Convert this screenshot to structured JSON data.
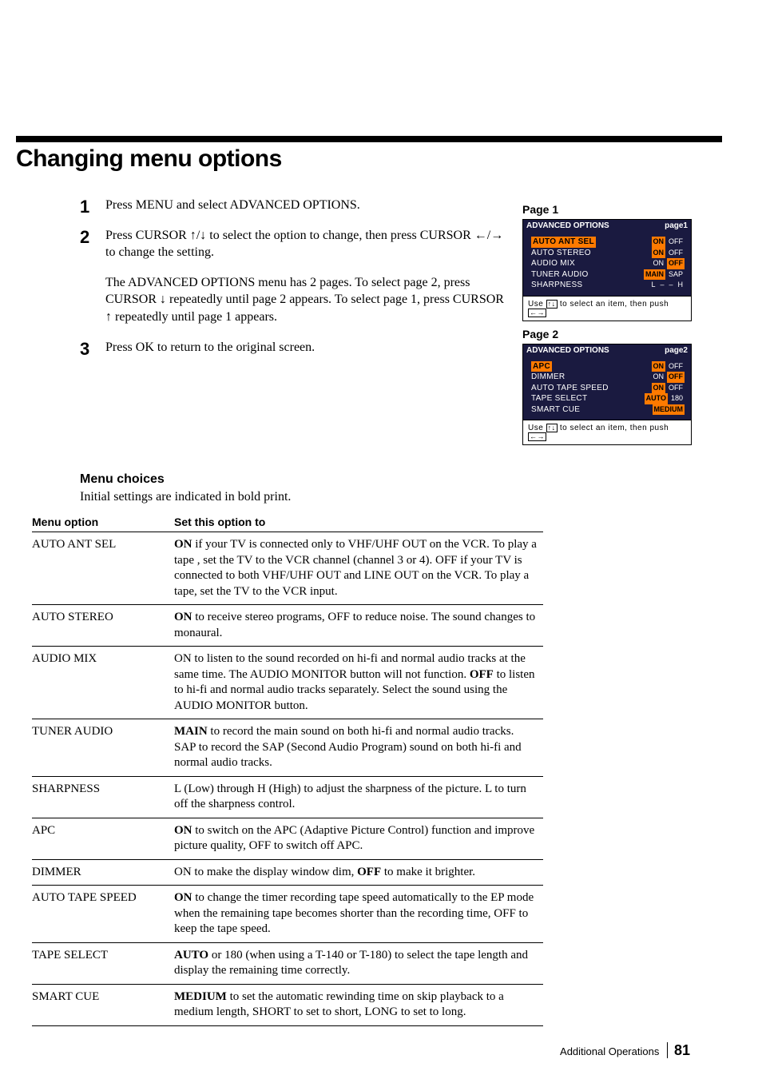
{
  "header": {
    "title": "Changing menu options"
  },
  "steps": [
    {
      "n": "1",
      "html": "Press MENU and select ADVANCED OPTIONS."
    },
    {
      "n": "2",
      "html": "Press CURSOR <span class='arrow-icon' data-name='arrow-up-icon'>↑</span>/<span class='arrow-icon' data-name='arrow-down-icon'>↓</span> to select the option to change, then press CURSOR <span class='arrow-icon' data-name='arrow-left-icon'>←</span>/<span class='arrow-icon' data-name='arrow-right-icon'>→</span> to change the setting."
    },
    {
      "n": "",
      "html": "The ADVANCED OPTIONS menu has 2 pages. To select page 2, press CURSOR <span class='arrow-icon' data-name='arrow-down-icon'>↓</span> repeatedly until page 2 appears. To select page 1, press CURSOR <span class='arrow-icon' data-name='arrow-up-icon'>↑</span> repeatedly until page 1 appears."
    },
    {
      "n": "3",
      "html": "Press OK to return to the original screen."
    }
  ],
  "osd": {
    "page1": {
      "label": "Page 1",
      "title": "ADVANCED OPTIONS",
      "pagebadge": "page1",
      "rows": [
        {
          "name": "AUTO ANT SEL",
          "vals": [
            "ON",
            "OFF"
          ],
          "hl": 0,
          "row_hl": true
        },
        {
          "name": "AUTO STEREO",
          "vals": [
            "ON",
            "OFF"
          ],
          "hl": 0
        },
        {
          "name": "AUDIO MIX",
          "vals": [
            "ON",
            "OFF"
          ],
          "hl": 1
        },
        {
          "name": "TUNER AUDIO",
          "vals": [
            "MAIN",
            "SAP"
          ],
          "hl": 0
        },
        {
          "name": "SHARPNESS",
          "vals": [
            "L",
            "–",
            "–",
            "H"
          ],
          "hl": null
        }
      ],
      "instr": "Use <span class='boxed-arrow'>↑↓</span> to select an item, then push <span class='boxed-arrow'>←→</span>"
    },
    "page2": {
      "label": "Page 2",
      "title": "ADVANCED OPTIONS",
      "pagebadge": "page2",
      "rows": [
        {
          "name": "APC",
          "vals": [
            "ON",
            "OFF"
          ],
          "hl": 0,
          "row_hl": true
        },
        {
          "name": "DIMMER",
          "vals": [
            "ON",
            "OFF"
          ],
          "hl": 1
        },
        {
          "name": "AUTO TAPE SPEED",
          "vals": [
            "ON",
            "OFF"
          ],
          "hl": 0
        },
        {
          "name": "TAPE SELECT",
          "vals": [
            "AUTO",
            "180"
          ],
          "hl": 0
        },
        {
          "name": "SMART CUE",
          "vals": [
            "MEDIUM"
          ],
          "hl": 0
        }
      ],
      "instr": "Use <span class='boxed-arrow'>↑↓</span> to select an item, then push <span class='boxed-arrow'>←→</span>"
    }
  },
  "menu": {
    "heading": "Menu choices",
    "note": "Initial settings are indicated in bold print.",
    "col1": "Menu option",
    "col2": "Set this option to",
    "options": [
      {
        "name": "AUTO ANT SEL",
        "desc": "<b>ON</b> if your TV is connected only to VHF/UHF OUT on the VCR. To play a tape , set the TV to the VCR channel (channel 3 or 4). OFF if your TV is connected to both VHF/UHF OUT and LINE OUT on the VCR. To play a tape, set the TV to the VCR input."
      },
      {
        "name": "AUTO STEREO",
        "desc": "<b>ON</b> to receive stereo programs, OFF to reduce noise. The sound changes to monaural."
      },
      {
        "name": "AUDIO MIX",
        "desc": "ON to listen to the sound recorded on hi-fi and normal audio tracks at the same time. The AUDIO MONITOR button will not function. <b>OFF</b> to listen to hi-fi and normal audio tracks separately. Select the sound using the AUDIO MONITOR button."
      },
      {
        "name": "TUNER AUDIO",
        "desc": "<b>MAIN</b> to record the main sound on both hi-fi and normal audio tracks. SAP to record the SAP (Second Audio Program) sound on both hi-fi and normal audio tracks."
      },
      {
        "name": "SHARPNESS",
        "desc": "L (Low) through H (High) to adjust the sharpness of the picture. L to turn off the sharpness control."
      },
      {
        "name": "APC",
        "desc": "<b>ON</b> to switch on the APC (Adaptive Picture Control) function and improve picture quality, OFF to switch off APC."
      },
      {
        "name": "DIMMER",
        "desc": "ON to make the display window dim, <b>OFF</b> to make it brighter."
      },
      {
        "name": "AUTO TAPE SPEED",
        "desc": "<b>ON</b> to change the timer recording tape speed automatically to the EP mode when the remaining tape becomes shorter than the recording time, OFF to keep the tape speed."
      },
      {
        "name": "TAPE SELECT",
        "desc": "<b>AUTO</b> or 180 (when using a T-140 or T-180) to select the tape length and display the remaining time correctly."
      },
      {
        "name": "SMART CUE",
        "desc": "<b>MEDIUM</b> to set the automatic rewinding time on skip playback to a medium length, SHORT to set to short, LONG to set to long."
      }
    ]
  },
  "footer": {
    "section": "Additional Operations",
    "page": "81"
  }
}
